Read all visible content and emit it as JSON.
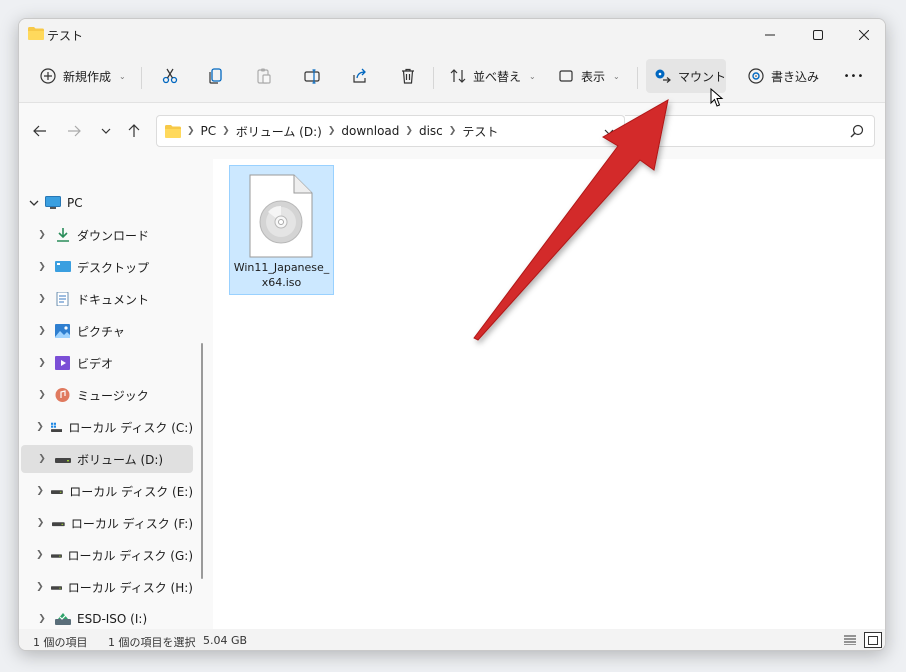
{
  "window": {
    "title": "テスト"
  },
  "toolbar": {
    "new_label": "新規作成",
    "sort_label": "並べ替え",
    "view_label": "表示",
    "mount_label": "マウント",
    "burn_label": "書き込み",
    "more_label": "•••"
  },
  "address": {
    "crumbs": [
      "PC",
      "ボリューム (D:)",
      "download",
      "disc",
      "テスト"
    ]
  },
  "nav": {
    "pc": "PC",
    "items": [
      {
        "label": "ダウンロード",
        "icon": "download-icon"
      },
      {
        "label": "デスクトップ",
        "icon": "desktop-icon"
      },
      {
        "label": "ドキュメント",
        "icon": "documents-icon"
      },
      {
        "label": "ピクチャ",
        "icon": "pictures-icon"
      },
      {
        "label": "ビデオ",
        "icon": "videos-icon"
      },
      {
        "label": "ミュージック",
        "icon": "music-icon"
      },
      {
        "label": "ローカル ディスク (C:)",
        "icon": "system-drive-icon"
      },
      {
        "label": "ボリューム (D:)",
        "icon": "drive-icon",
        "selected": true
      },
      {
        "label": "ローカル ディスク (E:)",
        "icon": "drive-icon"
      },
      {
        "label": "ローカル ディスク (F:)",
        "icon": "drive-icon"
      },
      {
        "label": "ローカル ディスク (G:)",
        "icon": "drive-icon"
      },
      {
        "label": "ローカル ディスク (H:)",
        "icon": "drive-icon"
      },
      {
        "label": "ESD-ISO (I:)",
        "icon": "mounted-disc-icon"
      }
    ]
  },
  "content": {
    "files": [
      {
        "name": "Win11_Japanese_x64.iso",
        "icon": "disc-image-icon",
        "selected": true
      }
    ]
  },
  "status": {
    "count": "1 個の項目",
    "selection": "1 個の項目を選択",
    "size": "5.04 GB"
  },
  "colors": {
    "accent": "#0067c0",
    "selection": "#cce8ff",
    "arrow": "#d32a2a"
  }
}
